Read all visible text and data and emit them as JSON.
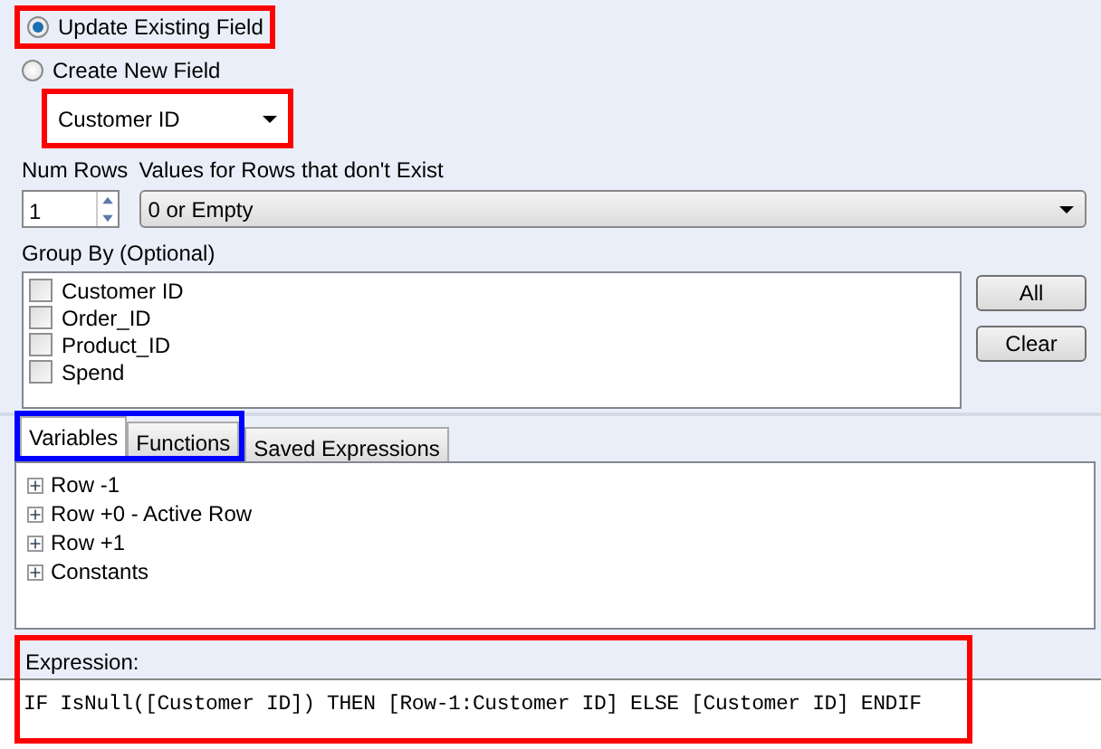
{
  "field_mode": [
    {
      "label": "Update Existing Field",
      "selected": true,
      "highlight": {
        "color": "#ff0000"
      }
    },
    {
      "label": "Create New  Field",
      "selected": false
    }
  ],
  "existing_field": {
    "value": "Customer ID",
    "highlight": {
      "color": "#ff0000"
    }
  },
  "num_rows": {
    "label": "Num Rows",
    "value": "1"
  },
  "missing_values": {
    "label": "Values for Rows that don't Exist",
    "value": "0 or Empty"
  },
  "group_by": {
    "label": "Group By (Optional)",
    "items": [
      {
        "label": "Customer ID",
        "checked": false
      },
      {
        "label": "Order_ID",
        "checked": false
      },
      {
        "label": "Product_ID",
        "checked": false
      },
      {
        "label": "Spend",
        "checked": false
      }
    ],
    "buttons": [
      "All",
      "Clear"
    ]
  },
  "tabs": [
    {
      "label": "Variables",
      "selected": true
    },
    {
      "label": "Functions",
      "selected": false
    },
    {
      "label": "Saved Expressions",
      "selected": false
    }
  ],
  "tabs_highlight": {
    "color": "#0000ff"
  },
  "tree": [
    {
      "label": "Row -1",
      "expanded": false
    },
    {
      "label": "Row +0 - Active Row",
      "expanded": false
    },
    {
      "label": "Row +1",
      "expanded": false
    },
    {
      "label": "Constants",
      "expanded": false
    }
  ],
  "expression": {
    "label": "Expression:",
    "value": "IF IsNull([Customer ID]) THEN [Row-1:Customer ID] ELSE [Customer ID] ENDIF",
    "highlight": {
      "color": "#ff0000"
    }
  }
}
